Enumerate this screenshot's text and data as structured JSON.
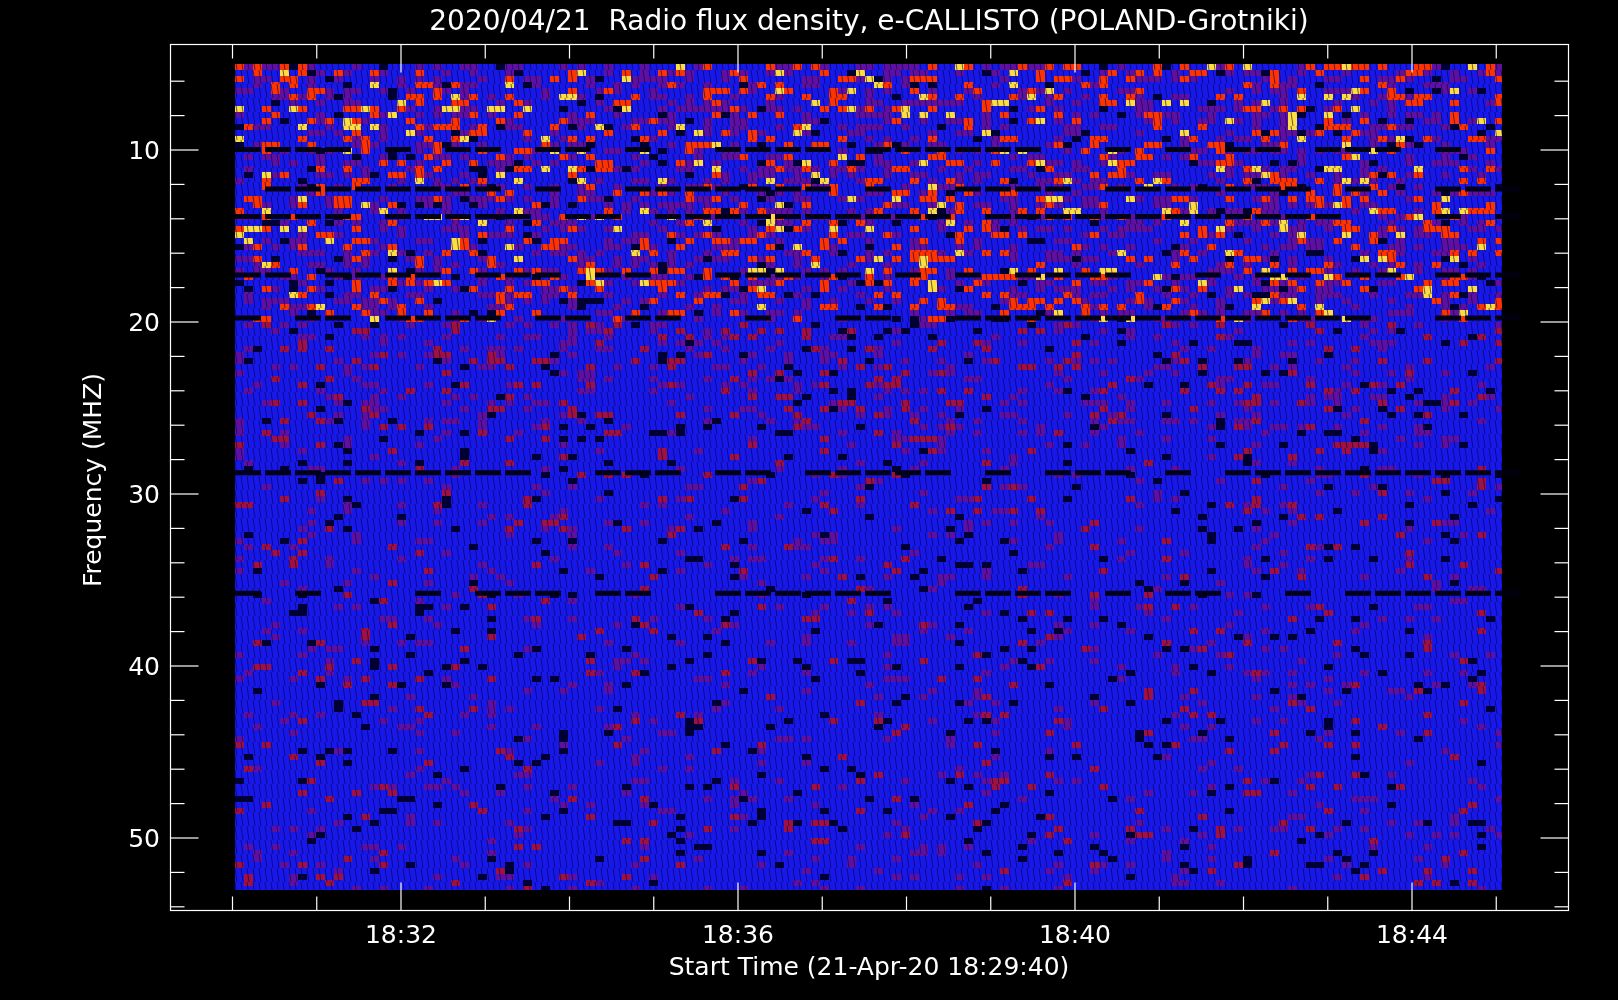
{
  "title": "2020/04/21  Radio flux density, e-CALLISTO (POLAND-Grotniki)",
  "y_axis": {
    "label": "Frequency (MHZ)",
    "ticks": [
      "10",
      "20",
      "30",
      "40",
      "50"
    ]
  },
  "x_axis": {
    "label": "Start Time (21-Apr-20 18:29:40)",
    "ticks": [
      "18:32",
      "18:36",
      "18:40",
      "18:44"
    ]
  }
}
